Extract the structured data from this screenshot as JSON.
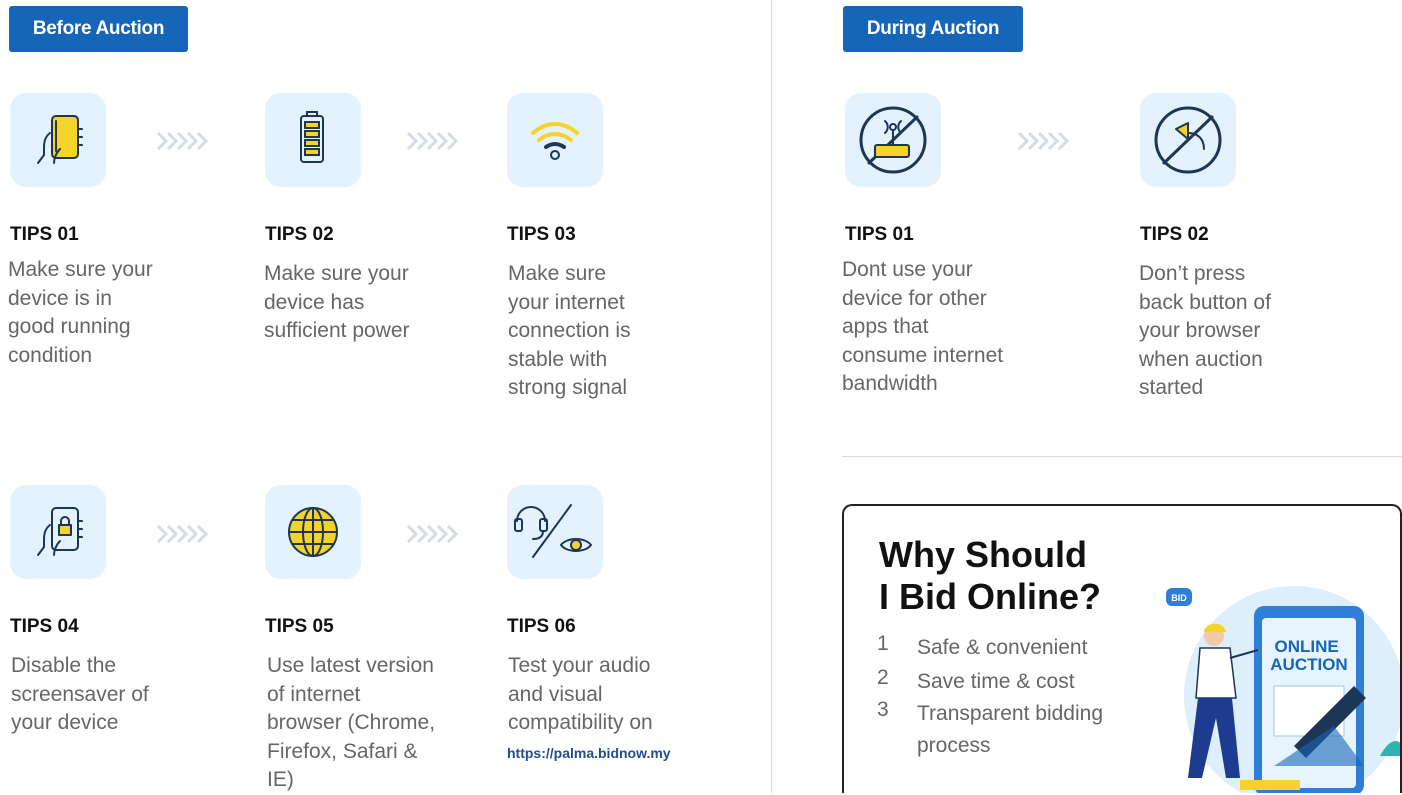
{
  "before": {
    "heading": "Before Auction",
    "tips": [
      {
        "title": "TIPS 01",
        "text": "Make sure your\ndevice is in\ngood running\ncondition",
        "icon": "phone-hand-icon"
      },
      {
        "title": "TIPS 02",
        "text": "Make sure your\ndevice has\nsufficient  power",
        "icon": "battery-icon"
      },
      {
        "title": "TIPS 03",
        "text": "Make sure\nyour internet\nconnection is\nstable with\nstrong signal",
        "icon": "wifi-icon"
      },
      {
        "title": "TIPS 04",
        "text": "Disable the\nscreensaver of\nyour device",
        "icon": "phone-lock-icon"
      },
      {
        "title": "TIPS 05",
        "text": "Use latest version\nof internet\nbrowser (Chrome,\nFirefox, Safari &\nIE)",
        "icon": "globe-icon"
      },
      {
        "title": "TIPS 06",
        "text": "Test your audio\nand visual\ncompatibility on",
        "link": "https://palma.bidnow.my",
        "icon": "headset-eye-icon"
      }
    ]
  },
  "during": {
    "heading": "During Auction",
    "tips": [
      {
        "title": "TIPS 01",
        "text": "Dont use your\ndevice for other\napps that\nconsume internet\nbandwidth",
        "icon": "no-router-icon"
      },
      {
        "title": "TIPS 02",
        "text": "Don’t press\nback button of\nyour browser\nwhen auction\nstarted",
        "icon": "no-back-icon"
      }
    ]
  },
  "why": {
    "title": "Why Should\nI Bid Online?",
    "items": [
      {
        "num": "1",
        "label": "Safe & convenient"
      },
      {
        "num": "2",
        "label": "Save time & cost"
      },
      {
        "num": "3",
        "label": "Transparent bidding\nprocess"
      }
    ],
    "illustration": {
      "screen_text": "ONLINE\nAUCTION",
      "bubble_text": "BID"
    }
  },
  "colors": {
    "accent": "#1565b8",
    "icon_bg": "#e3f2fc",
    "icon_yellow": "#f6d32a",
    "icon_stroke": "#1d3557"
  }
}
